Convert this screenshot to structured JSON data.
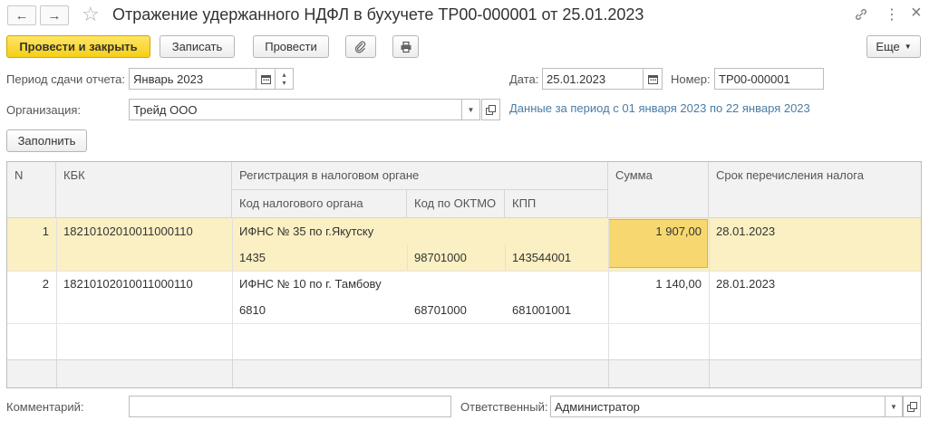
{
  "window": {
    "title": "Отражение удержанного НДФЛ в бухучете ТР00-000001 от 25.01.2023",
    "back_icon": "←",
    "forward_icon": "→",
    "favorite_icon": "☆",
    "link_icon": "🔗",
    "more_icon": "⋮",
    "close_icon": "×"
  },
  "toolbar": {
    "post_close_label": "Провести и закрыть",
    "save_label": "Записать",
    "post_label": "Провести",
    "attach_icon": "📎",
    "print_icon": "🖨",
    "more_label": "Еще"
  },
  "form": {
    "period_label": "Период сдачи отчета:",
    "period_value": "Январь 2023",
    "date_label": "Дата:",
    "date_value": "25.01.2023",
    "number_label": "Номер:",
    "number_value": "ТР00-000001",
    "org_label": "Организация:",
    "org_value": "Трейд ООО",
    "period_info": "Данные за период с 01 января 2023 по 22 января 2023",
    "fill_label": "Заполнить",
    "comment_label": "Комментарий:",
    "comment_value": "",
    "responsible_label": "Ответственный:",
    "responsible_value": "Администратор"
  },
  "table": {
    "headers": {
      "n": "N",
      "kbk": "КБК",
      "registration": "Регистрация в налоговом органе",
      "tax_code": "Код налогового органа",
      "oktmo": "Код по ОКТМО",
      "kpp": "КПП",
      "sum": "Сумма",
      "due": "Срок перечисления налога"
    },
    "rows": [
      {
        "n": "1",
        "kbk": "18210102010011000110",
        "authority": "ИФНС № 35 по г.Якутску",
        "tax_code": "1435",
        "oktmo": "98701000",
        "kpp": "143544001",
        "sum": "1 907,00",
        "due": "28.01.2023"
      },
      {
        "n": "2",
        "kbk": "18210102010011000110",
        "authority": "ИФНС № 10 по г. Тамбову",
        "tax_code": "6810",
        "oktmo": "68701000",
        "kpp": "681001001",
        "sum": "1 140,00",
        "due": "28.01.2023"
      }
    ]
  }
}
